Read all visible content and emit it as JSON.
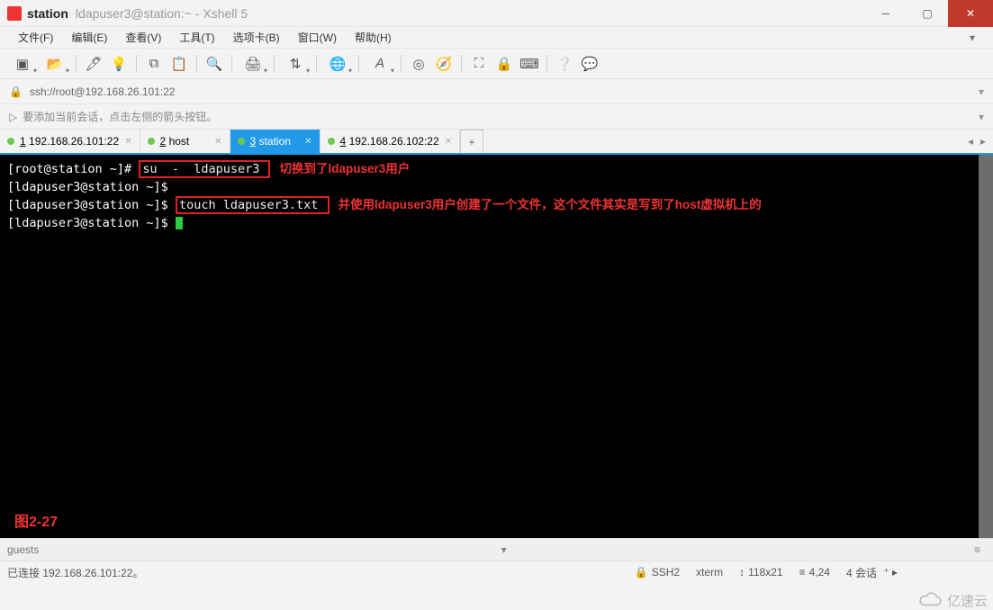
{
  "titlebar": {
    "session": "station",
    "full": "ldapuser3@station:~ - Xshell 5"
  },
  "menus": [
    "文件(F)",
    "编辑(E)",
    "查看(V)",
    "工具(T)",
    "选项卡(B)",
    "窗口(W)",
    "帮助(H)"
  ],
  "url": "ssh://root@192.168.26.101:22",
  "infobar": "要添加当前会话，点击左侧的箭头按钮。",
  "tabs": [
    {
      "num": "1",
      "label": "192.168.26.101:22",
      "active": false
    },
    {
      "num": "2",
      "label": "host",
      "active": false
    },
    {
      "num": "3",
      "label": "station",
      "active": true
    },
    {
      "num": "4",
      "label": "192.168.26.102:22",
      "active": false
    }
  ],
  "term": {
    "p1": "[root@station ~]# ",
    "cmd1": "su  -  ldapuser3 ",
    "anno1": "切换到了ldapuser3用户",
    "p2": "[ldapuser3@station ~]$",
    "p3": "[ldapuser3@station ~]$ ",
    "cmd2": "touch ldapuser3.txt ",
    "anno2": "并使用ldapuser3用户创建了一个文件，这个文件其实是写到了host虚拟机上的",
    "p4": "[ldapuser3@station ~]$ ",
    "fig": "图2-27"
  },
  "guests": "guests",
  "status": {
    "conn": "已连接 192.168.26.101:22。",
    "proto": "SSH2",
    "term": "xterm",
    "size": "118x21",
    "pos": "4,24",
    "sessions": "4 会话"
  },
  "watermark": "亿速云"
}
